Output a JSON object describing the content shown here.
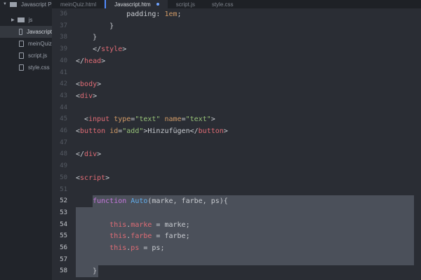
{
  "sidebar": {
    "project": "Javascript P",
    "items": [
      {
        "label": "js",
        "type": "folder"
      },
      {
        "label": "Javascript",
        "type": "file",
        "selected": true
      },
      {
        "label": "meinQuiz",
        "type": "file"
      },
      {
        "label": "script.js",
        "type": "file"
      },
      {
        "label": "style.css",
        "type": "file"
      }
    ]
  },
  "tabs": [
    {
      "label": "meinQuiz.html"
    },
    {
      "label": "Javascript.htm",
      "active": true,
      "modified": true
    },
    {
      "label": "script.js"
    },
    {
      "label": "style.css"
    }
  ],
  "lines": [
    {
      "n": "36",
      "html": "            padding: <span class='a'>1em</span>;"
    },
    {
      "n": "37",
      "html": "        }"
    },
    {
      "n": "38",
      "html": "    }"
    },
    {
      "n": "39",
      "html": "    &lt;/<span class='t'>style</span>&gt;"
    },
    {
      "n": "40",
      "html": "&lt;/<span class='t'>head</span>&gt;"
    },
    {
      "n": "41",
      "html": ""
    },
    {
      "n": "42",
      "html": "&lt;<span class='t'>body</span>&gt;"
    },
    {
      "n": "43",
      "html": "&lt;<span class='t'>div</span>&gt;"
    },
    {
      "n": "44",
      "html": ""
    },
    {
      "n": "45",
      "html": "  &lt;<span class='t'>input</span> <span class='a'>type</span>=<span class='s'>\"text\"</span> <span class='a'>name</span>=<span class='s'>\"text\"</span>&gt;"
    },
    {
      "n": "46",
      "html": "&lt;<span class='t'>button</span> <span class='a'>id</span>=<span class='s'>\"add\"</span>&gt;Hinzufügen&lt;/<span class='t'>button</span>&gt;"
    },
    {
      "n": "47",
      "html": ""
    },
    {
      "n": "48",
      "html": "&lt;/<span class='t'>div</span>&gt;"
    },
    {
      "n": "49",
      "html": ""
    },
    {
      "n": "50",
      "html": "&lt;<span class='t'>script</span>&gt;"
    },
    {
      "n": "51",
      "html": ""
    },
    {
      "n": "52",
      "html": "    <span class='k'>function</span> <span class='f'>Auto</span>(marke, farbe, ps){"
    },
    {
      "n": "53",
      "html": ""
    },
    {
      "n": "54",
      "html": "        <span class='t'>this</span>.<span class='t'>marke</span> = marke;"
    },
    {
      "n": "55",
      "html": "        <span class='t'>this</span>.<span class='t'>farbe</span> = farbe;"
    },
    {
      "n": "56",
      "html": "        <span class='t'>this</span>.<span class='t'>ps</span> = ps;"
    },
    {
      "n": "57",
      "html": ""
    },
    {
      "n": "58",
      "html": "    }"
    }
  ],
  "selection": {
    "from_line": "52",
    "to_line": "58"
  }
}
